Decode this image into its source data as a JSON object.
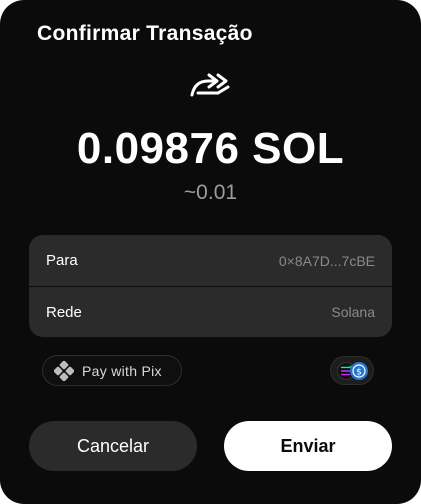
{
  "dialog": {
    "title": "Confirmar Transação",
    "icon": "send-arrows-icon"
  },
  "amount": {
    "value": "0.09876 SOL",
    "fiat": "~0.01"
  },
  "details": [
    {
      "label": "Para",
      "value": "0×8A7D...7cBE"
    },
    {
      "label": "Rede",
      "value": "Solana"
    }
  ],
  "pix": {
    "label": "Pay with Pix",
    "icon": "pix-icon"
  },
  "chain_badge": {
    "icons": [
      "solana-icon",
      "usdc-icon"
    ],
    "accent": "#2775ca"
  },
  "actions": {
    "cancel": "Cancelar",
    "send": "Enviar"
  },
  "colors": {
    "background": "#0b0b0b",
    "card": "#2b2b2b",
    "primary_button": "#ffffff"
  }
}
